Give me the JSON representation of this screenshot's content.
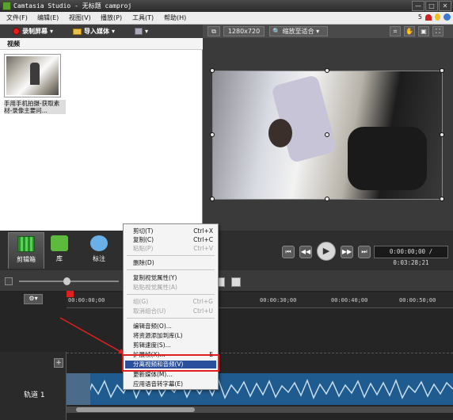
{
  "window": {
    "title": "Camtasia Studio - 无标题 camproj",
    "buttons": [
      "—",
      "□",
      "✕"
    ]
  },
  "menubar": {
    "items": [
      "文件(F)",
      "编辑(E)",
      "视图(V)",
      "播放(P)",
      "工具(T)",
      "帮助(H)"
    ],
    "notification_count": "5"
  },
  "toolbar": {
    "record_label": "录制屏幕",
    "import_label": "导入媒体"
  },
  "clipbin": {
    "header": "视频",
    "clip_caption": "手用手机拍摄-获取素材-录像主要问..."
  },
  "preview": {
    "resolution": "1280x720",
    "zoom": "缩放至适合"
  },
  "tabs": [
    {
      "label": "剪辑箱"
    },
    {
      "label": "库"
    },
    {
      "label": "标注"
    }
  ],
  "playback": {
    "time": "0:00:00;00 / 0:03:28;21"
  },
  "timeline": {
    "ticks": [
      "00:00:00;00",
      "00:00:30;00",
      "00:00:40;00",
      "00:00:50;00"
    ],
    "track_label": "轨道 1"
  },
  "context_menu": {
    "items": [
      {
        "label": "剪切(T)",
        "shortcut": "Ctrl+X",
        "disabled": false
      },
      {
        "label": "复制(C)",
        "shortcut": "Ctrl+C",
        "disabled": false
      },
      {
        "label": "粘贴(P)",
        "shortcut": "Ctrl+V",
        "disabled": true
      },
      {
        "label": "删除(D)",
        "shortcut": "",
        "disabled": false
      },
      {
        "label": "复制视觉属性(Y)",
        "shortcut": "",
        "disabled": false
      },
      {
        "label": "粘贴视觉属性(A)",
        "shortcut": "",
        "disabled": true
      },
      {
        "label": "组(G)",
        "shortcut": "Ctrl+G",
        "disabled": true
      },
      {
        "label": "取消组合(U)",
        "shortcut": "Ctrl+U",
        "disabled": true
      },
      {
        "label": "编辑音频(O)...",
        "shortcut": "",
        "disabled": false
      },
      {
        "label": "将资源添加到库(L)",
        "shortcut": "",
        "disabled": false
      },
      {
        "label": "剪辑速度(S)...",
        "shortcut": "",
        "disabled": false
      },
      {
        "label": "扩展帧(X)...",
        "shortcut": "E",
        "disabled": false
      },
      {
        "label": "分离视频和音频(V)",
        "shortcut": "",
        "disabled": false,
        "highlighted": true
      },
      {
        "label": "更新媒体(M)...",
        "shortcut": "",
        "disabled": false
      },
      {
        "label": "应用语音转字幕(E)",
        "shortcut": "",
        "disabled": false
      }
    ]
  },
  "colors": {
    "highlight": "#2a4f9c",
    "annotation_red": "#e02020",
    "track_blue": "#1f5b8e"
  }
}
